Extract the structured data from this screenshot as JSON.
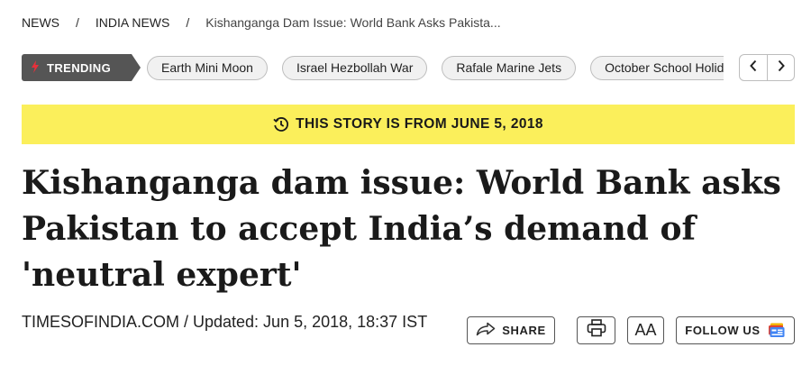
{
  "breadcrumb": {
    "items": [
      "NEWS",
      "INDIA NEWS"
    ],
    "separator": "/",
    "current": "Kishanganga Dam Issue: World Bank Asks Pakista..."
  },
  "trending": {
    "label": "TRENDING",
    "topics": [
      "Earth Mini Moon",
      "Israel Hezbollah War",
      "Rafale Marine Jets",
      "October School Holid"
    ],
    "prev_icon": "chevron-left-icon",
    "next_icon": "chevron-right-icon"
  },
  "story_banner": {
    "text": "THIS STORY IS FROM JUNE 5, 2018",
    "color": "#fbef5b"
  },
  "article": {
    "headline": "Kishanganga dam issue: World Bank asks Pakistan to accept India’s demand of 'neutral expert'",
    "byline": "TIMESOFINDIA.COM / Updated: Jun 5, 2018, 18:37 IST"
  },
  "actions": {
    "share_label": "SHARE",
    "font_size_label": "AA",
    "follow_label": "FOLLOW US"
  },
  "colors": {
    "trending_badge": "#555555",
    "trending_flame": "#e8303a",
    "chip_background": "#f1f1f1"
  }
}
